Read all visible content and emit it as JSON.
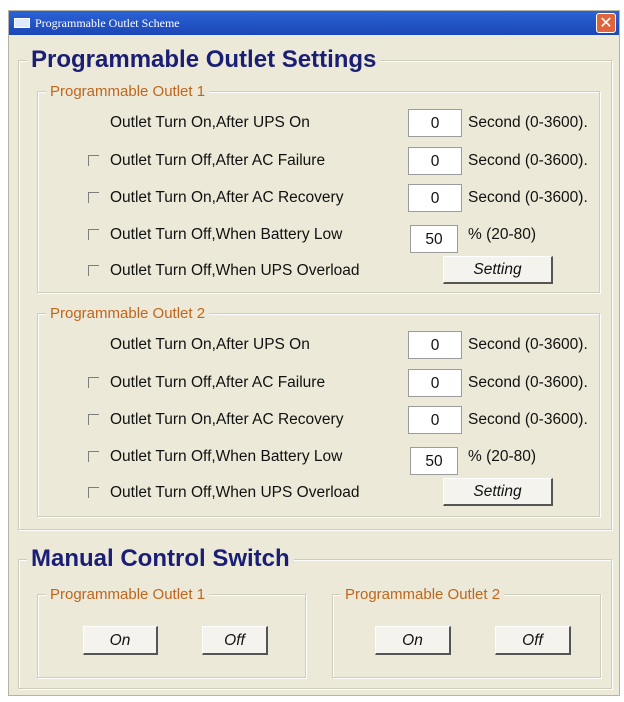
{
  "window": {
    "title": "Programmable Outlet Scheme",
    "close_glyph": "✕"
  },
  "settings": {
    "heading": "Programmable Outlet Settings",
    "outlets": [
      {
        "label": "Programmable Outlet 1",
        "rows": [
          {
            "text": "Outlet Turn On,After UPS On",
            "value": "0",
            "unit": "Second (0-3600)."
          },
          {
            "text": "Outlet Turn Off,After AC Failure",
            "value": "0",
            "unit": "Second (0-3600)."
          },
          {
            "text": "Outlet Turn On,After AC Recovery",
            "value": "0",
            "unit": "Second (0-3600)."
          },
          {
            "text": "Outlet Turn Off,When Battery Low",
            "value": "50",
            "unit": "% (20-80)"
          },
          {
            "text": "Outlet Turn Off,When UPS Overload",
            "button": "Setting"
          }
        ]
      },
      {
        "label": "Programmable Outlet 2",
        "rows": [
          {
            "text": "Outlet Turn On,After UPS On",
            "value": "0",
            "unit": "Second (0-3600)."
          },
          {
            "text": "Outlet Turn Off,After AC Failure",
            "value": "0",
            "unit": "Second (0-3600)."
          },
          {
            "text": "Outlet Turn On,After AC Recovery",
            "value": "0",
            "unit": "Second (0-3600)."
          },
          {
            "text": "Outlet Turn Off,When Battery Low",
            "value": "50",
            "unit": "% (20-80)"
          },
          {
            "text": "Outlet Turn Off,When UPS Overload",
            "button": "Setting"
          }
        ]
      }
    ]
  },
  "manual": {
    "heading": "Manual Control Switch",
    "outlets": [
      {
        "label": "Programmable Outlet 1",
        "on": "On",
        "off": "Off"
      },
      {
        "label": "Programmable Outlet 2",
        "on": "On",
        "off": "Off"
      }
    ]
  }
}
